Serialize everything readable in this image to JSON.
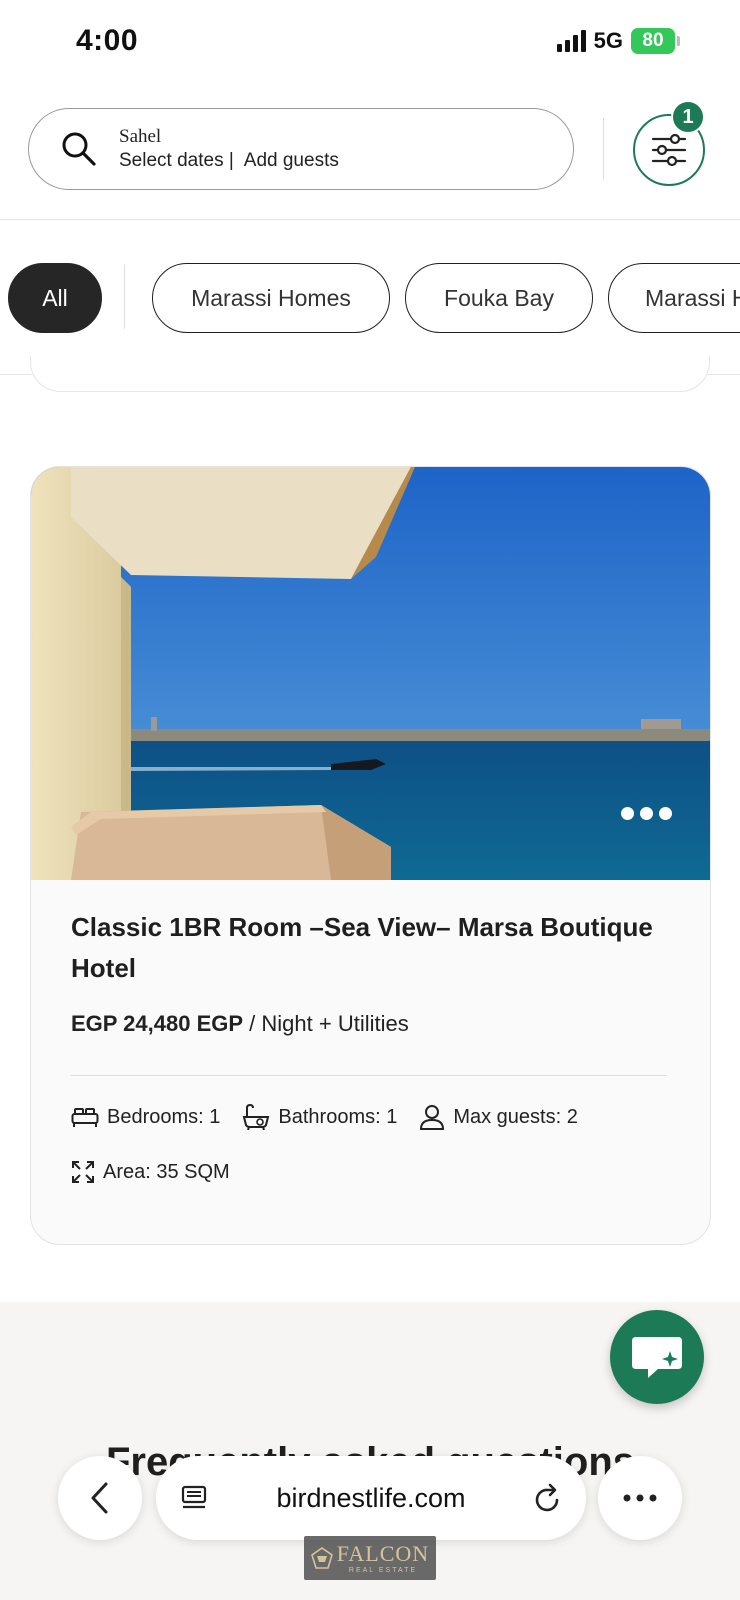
{
  "status_bar": {
    "time": "4:00",
    "network": "5G",
    "battery": "80"
  },
  "search": {
    "location": "Sahel",
    "dates": "Select dates |",
    "guests": "Add guests",
    "filter_count": "1"
  },
  "categories": [
    {
      "label": "All",
      "active": true
    },
    {
      "label": "Marassi Homes",
      "active": false
    },
    {
      "label": "Fouka Bay",
      "active": false
    },
    {
      "label": "Marassi H",
      "active": false
    }
  ],
  "listing": {
    "title": "Classic 1BR Room –Sea View– Marsa Boutique Hotel",
    "price": "EGP 24,480 EGP",
    "price_suffix": "/ Night + Utilities",
    "bedrooms": "Bedrooms: 1",
    "bathrooms": "Bathrooms: 1",
    "max_guests": "Max guests: 2",
    "area": "Area: 35 SQM"
  },
  "faq": {
    "title": "Frequently asked questions"
  },
  "browser": {
    "url": "birdnestlife.com"
  },
  "watermark": {
    "main": "FALCON",
    "sub": "REAL ESTATE"
  },
  "colors": {
    "brand_green": "#1d7a56",
    "chip_active": "#262626",
    "battery_green": "#34c759"
  }
}
